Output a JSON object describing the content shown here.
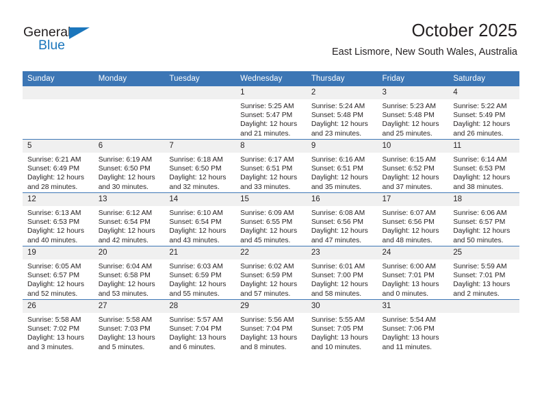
{
  "logo": {
    "word_top": "General",
    "word_bottom": "Blue",
    "accent_color": "#1b76bc"
  },
  "header": {
    "title": "October 2025",
    "subtitle": "East Lismore, New South Wales, Australia"
  },
  "theme": {
    "header_blue": "#3c76b5",
    "daynum_band": "#f0f0f0",
    "text": "#231f20"
  },
  "calendar": {
    "weekday_headers": [
      "Sunday",
      "Monday",
      "Tuesday",
      "Wednesday",
      "Thursday",
      "Friday",
      "Saturday"
    ],
    "weeks": [
      [
        {
          "day": "",
          "empty": true
        },
        {
          "day": "",
          "empty": true
        },
        {
          "day": "",
          "empty": true
        },
        {
          "day": "1",
          "sunrise": "Sunrise: 5:25 AM",
          "sunset": "Sunset: 5:47 PM",
          "daylight1": "Daylight: 12 hours",
          "daylight2": "and 21 minutes."
        },
        {
          "day": "2",
          "sunrise": "Sunrise: 5:24 AM",
          "sunset": "Sunset: 5:48 PM",
          "daylight1": "Daylight: 12 hours",
          "daylight2": "and 23 minutes."
        },
        {
          "day": "3",
          "sunrise": "Sunrise: 5:23 AM",
          "sunset": "Sunset: 5:48 PM",
          "daylight1": "Daylight: 12 hours",
          "daylight2": "and 25 minutes."
        },
        {
          "day": "4",
          "sunrise": "Sunrise: 5:22 AM",
          "sunset": "Sunset: 5:49 PM",
          "daylight1": "Daylight: 12 hours",
          "daylight2": "and 26 minutes."
        }
      ],
      [
        {
          "day": "5",
          "sunrise": "Sunrise: 6:21 AM",
          "sunset": "Sunset: 6:49 PM",
          "daylight1": "Daylight: 12 hours",
          "daylight2": "and 28 minutes."
        },
        {
          "day": "6",
          "sunrise": "Sunrise: 6:19 AM",
          "sunset": "Sunset: 6:50 PM",
          "daylight1": "Daylight: 12 hours",
          "daylight2": "and 30 minutes."
        },
        {
          "day": "7",
          "sunrise": "Sunrise: 6:18 AM",
          "sunset": "Sunset: 6:50 PM",
          "daylight1": "Daylight: 12 hours",
          "daylight2": "and 32 minutes."
        },
        {
          "day": "8",
          "sunrise": "Sunrise: 6:17 AM",
          "sunset": "Sunset: 6:51 PM",
          "daylight1": "Daylight: 12 hours",
          "daylight2": "and 33 minutes."
        },
        {
          "day": "9",
          "sunrise": "Sunrise: 6:16 AM",
          "sunset": "Sunset: 6:51 PM",
          "daylight1": "Daylight: 12 hours",
          "daylight2": "and 35 minutes."
        },
        {
          "day": "10",
          "sunrise": "Sunrise: 6:15 AM",
          "sunset": "Sunset: 6:52 PM",
          "daylight1": "Daylight: 12 hours",
          "daylight2": "and 37 minutes."
        },
        {
          "day": "11",
          "sunrise": "Sunrise: 6:14 AM",
          "sunset": "Sunset: 6:53 PM",
          "daylight1": "Daylight: 12 hours",
          "daylight2": "and 38 minutes."
        }
      ],
      [
        {
          "day": "12",
          "sunrise": "Sunrise: 6:13 AM",
          "sunset": "Sunset: 6:53 PM",
          "daylight1": "Daylight: 12 hours",
          "daylight2": "and 40 minutes."
        },
        {
          "day": "13",
          "sunrise": "Sunrise: 6:12 AM",
          "sunset": "Sunset: 6:54 PM",
          "daylight1": "Daylight: 12 hours",
          "daylight2": "and 42 minutes."
        },
        {
          "day": "14",
          "sunrise": "Sunrise: 6:10 AM",
          "sunset": "Sunset: 6:54 PM",
          "daylight1": "Daylight: 12 hours",
          "daylight2": "and 43 minutes."
        },
        {
          "day": "15",
          "sunrise": "Sunrise: 6:09 AM",
          "sunset": "Sunset: 6:55 PM",
          "daylight1": "Daylight: 12 hours",
          "daylight2": "and 45 minutes."
        },
        {
          "day": "16",
          "sunrise": "Sunrise: 6:08 AM",
          "sunset": "Sunset: 6:56 PM",
          "daylight1": "Daylight: 12 hours",
          "daylight2": "and 47 minutes."
        },
        {
          "day": "17",
          "sunrise": "Sunrise: 6:07 AM",
          "sunset": "Sunset: 6:56 PM",
          "daylight1": "Daylight: 12 hours",
          "daylight2": "and 48 minutes."
        },
        {
          "day": "18",
          "sunrise": "Sunrise: 6:06 AM",
          "sunset": "Sunset: 6:57 PM",
          "daylight1": "Daylight: 12 hours",
          "daylight2": "and 50 minutes."
        }
      ],
      [
        {
          "day": "19",
          "sunrise": "Sunrise: 6:05 AM",
          "sunset": "Sunset: 6:57 PM",
          "daylight1": "Daylight: 12 hours",
          "daylight2": "and 52 minutes."
        },
        {
          "day": "20",
          "sunrise": "Sunrise: 6:04 AM",
          "sunset": "Sunset: 6:58 PM",
          "daylight1": "Daylight: 12 hours",
          "daylight2": "and 53 minutes."
        },
        {
          "day": "21",
          "sunrise": "Sunrise: 6:03 AM",
          "sunset": "Sunset: 6:59 PM",
          "daylight1": "Daylight: 12 hours",
          "daylight2": "and 55 minutes."
        },
        {
          "day": "22",
          "sunrise": "Sunrise: 6:02 AM",
          "sunset": "Sunset: 6:59 PM",
          "daylight1": "Daylight: 12 hours",
          "daylight2": "and 57 minutes."
        },
        {
          "day": "23",
          "sunrise": "Sunrise: 6:01 AM",
          "sunset": "Sunset: 7:00 PM",
          "daylight1": "Daylight: 12 hours",
          "daylight2": "and 58 minutes."
        },
        {
          "day": "24",
          "sunrise": "Sunrise: 6:00 AM",
          "sunset": "Sunset: 7:01 PM",
          "daylight1": "Daylight: 13 hours",
          "daylight2": "and 0 minutes."
        },
        {
          "day": "25",
          "sunrise": "Sunrise: 5:59 AM",
          "sunset": "Sunset: 7:01 PM",
          "daylight1": "Daylight: 13 hours",
          "daylight2": "and 2 minutes."
        }
      ],
      [
        {
          "day": "26",
          "sunrise": "Sunrise: 5:58 AM",
          "sunset": "Sunset: 7:02 PM",
          "daylight1": "Daylight: 13 hours",
          "daylight2": "and 3 minutes."
        },
        {
          "day": "27",
          "sunrise": "Sunrise: 5:58 AM",
          "sunset": "Sunset: 7:03 PM",
          "daylight1": "Daylight: 13 hours",
          "daylight2": "and 5 minutes."
        },
        {
          "day": "28",
          "sunrise": "Sunrise: 5:57 AM",
          "sunset": "Sunset: 7:04 PM",
          "daylight1": "Daylight: 13 hours",
          "daylight2": "and 6 minutes."
        },
        {
          "day": "29",
          "sunrise": "Sunrise: 5:56 AM",
          "sunset": "Sunset: 7:04 PM",
          "daylight1": "Daylight: 13 hours",
          "daylight2": "and 8 minutes."
        },
        {
          "day": "30",
          "sunrise": "Sunrise: 5:55 AM",
          "sunset": "Sunset: 7:05 PM",
          "daylight1": "Daylight: 13 hours",
          "daylight2": "and 10 minutes."
        },
        {
          "day": "31",
          "sunrise": "Sunrise: 5:54 AM",
          "sunset": "Sunset: 7:06 PM",
          "daylight1": "Daylight: 13 hours",
          "daylight2": "and 11 minutes."
        },
        {
          "day": "",
          "empty": true
        }
      ]
    ]
  }
}
